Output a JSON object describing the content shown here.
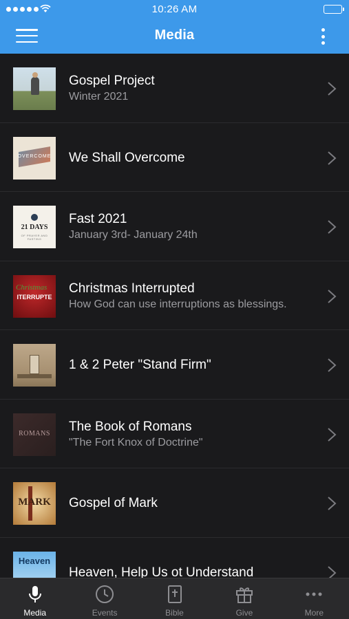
{
  "status": {
    "time": "10:26 AM"
  },
  "header": {
    "title": "Media"
  },
  "items": [
    {
      "title": "Gospel Project",
      "subtitle": "Winter 2021"
    },
    {
      "title": "We Shall Overcome",
      "subtitle": "",
      "thumb_text": "OVERCOME"
    },
    {
      "title": "Fast 2021",
      "subtitle": "January 3rd- January 24th",
      "thumb_text": "21 DAYS",
      "thumb_sub": "OF PRAYER AND FASTING"
    },
    {
      "title": "Christmas Interrupted",
      "subtitle": "How God can use interruptions as blessings.",
      "thumb_text": "ITERRUPTE"
    },
    {
      "title": "1 & 2 Peter \"Stand Firm\"",
      "subtitle": ""
    },
    {
      "title": "The Book of Romans",
      "subtitle": "\"The Fort Knox of Doctrine\"",
      "thumb_text": "ROMANS"
    },
    {
      "title": "Gospel of Mark",
      "subtitle": "",
      "thumb_text": "MARK"
    },
    {
      "title": "Heaven, Help Us ot Understand",
      "subtitle": "",
      "thumb_text": "Heaven"
    }
  ],
  "tabs": [
    {
      "label": "Media",
      "icon": "microphone-icon",
      "active": true
    },
    {
      "label": "Events",
      "icon": "clock-icon"
    },
    {
      "label": "Bible",
      "icon": "bible-icon"
    },
    {
      "label": "Give",
      "icon": "gift-icon"
    },
    {
      "label": "More",
      "icon": "more-dots-icon"
    }
  ],
  "colors": {
    "header": "#3d99ea",
    "background": "#1a1a1c",
    "tabbar": "#2a2a2c"
  }
}
